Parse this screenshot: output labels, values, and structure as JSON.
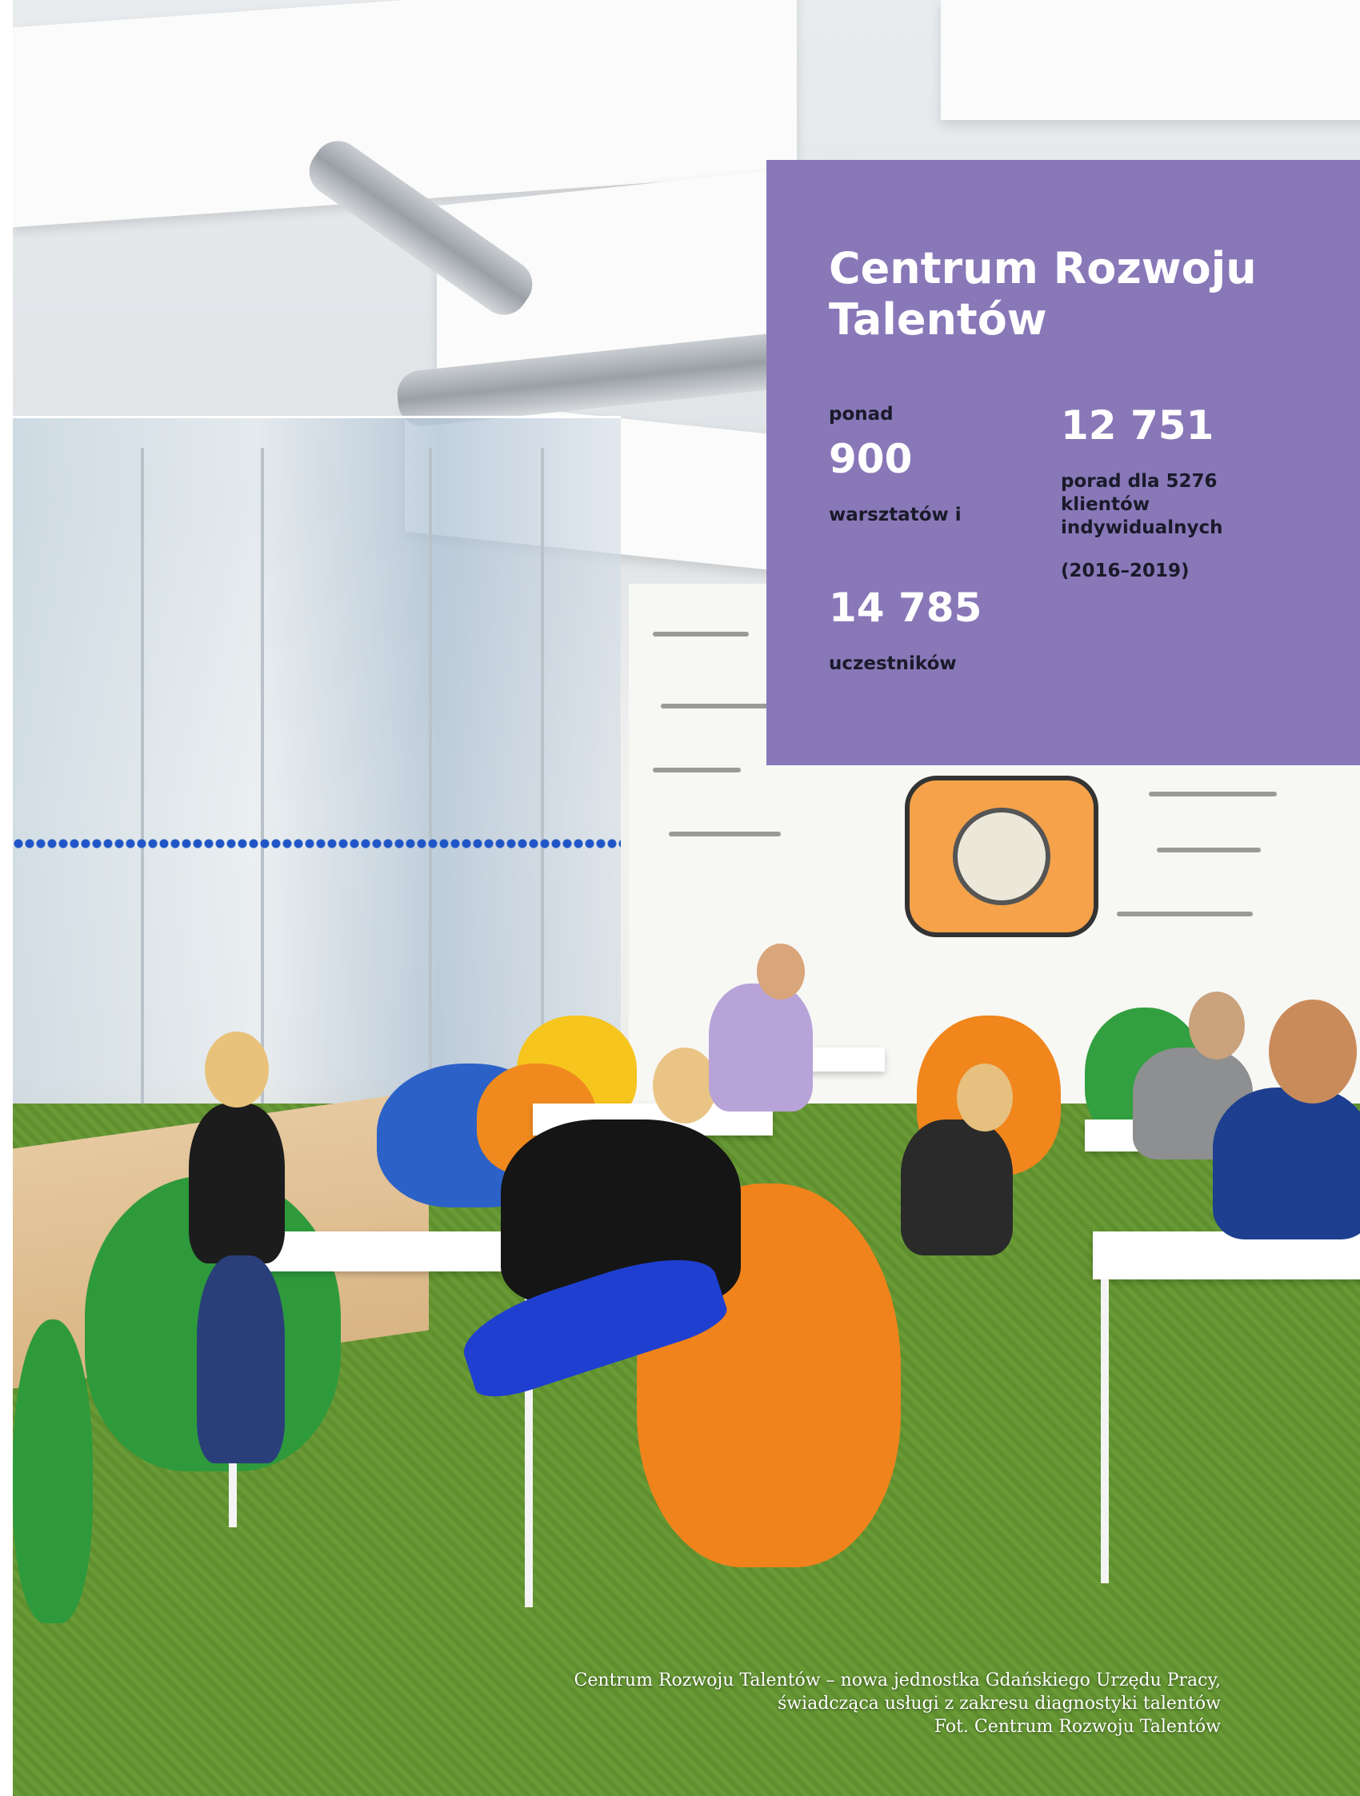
{
  "panel": {
    "title_line1": "Centrum Rozwoju",
    "title_line2": "Talentów",
    "stats": {
      "workshops_prefix": "ponad",
      "workshops_value": "900",
      "workshops_label": "warsztatów i",
      "participants_value": "14 785",
      "participants_label": "uczestników",
      "advice_value": "12 751",
      "advice_label": "porad dla 5276 klientów indywidualnych",
      "period": "(2016–2019)"
    },
    "background_color": "#8878b8"
  },
  "caption": {
    "line1": "Centrum Rozwoju Talentów – nowa jednostka Gdańskiego Urzędu Pracy,",
    "line2": "świadcząca usługi z zakresu diagnostyki talentów",
    "line3": "Fot. Centrum Rozwoju Talentów"
  }
}
